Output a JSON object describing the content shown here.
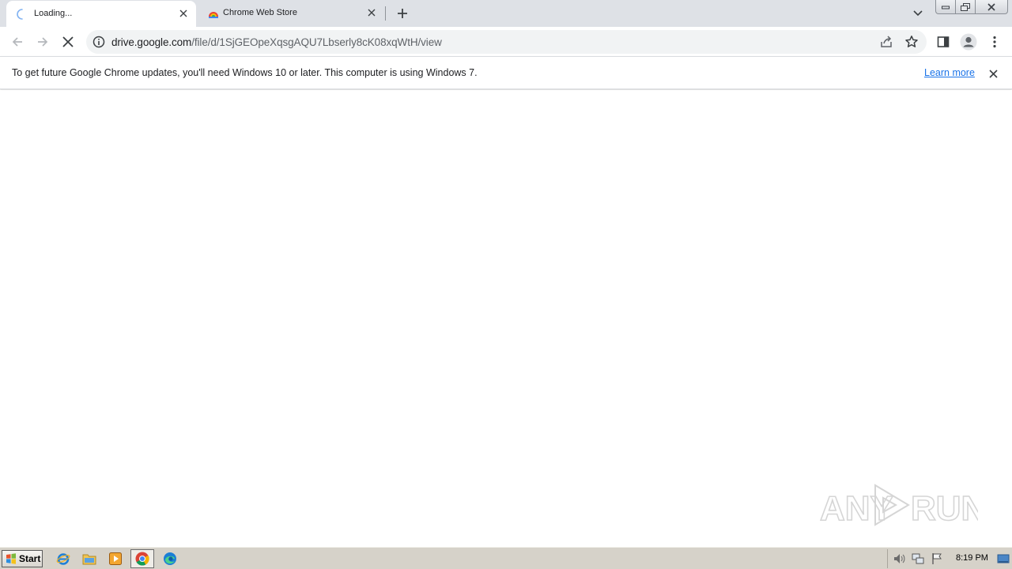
{
  "tabs": [
    {
      "title": "Loading...",
      "state": "loading"
    },
    {
      "title": "Chrome Web Store",
      "state": "inactive"
    }
  ],
  "toolbar": {
    "url_host": "drive.google.com",
    "url_path": "/file/d/1SjGEOpeXqsgAQU7Lbserly8cK08xqWtH/view"
  },
  "infobar": {
    "message": "To get future Google Chrome updates, you'll need Windows 10 or later. This computer is using Windows 7.",
    "link": "Learn more"
  },
  "watermark": {
    "text_left": "ANY",
    "text_right": "RUN"
  },
  "taskbar": {
    "start_label": "Start",
    "clock": "8:19 PM"
  },
  "colors": {
    "tabstrip": "#dee1e6",
    "link": "#1a73e8",
    "taskbar": "#d6d2c9"
  }
}
